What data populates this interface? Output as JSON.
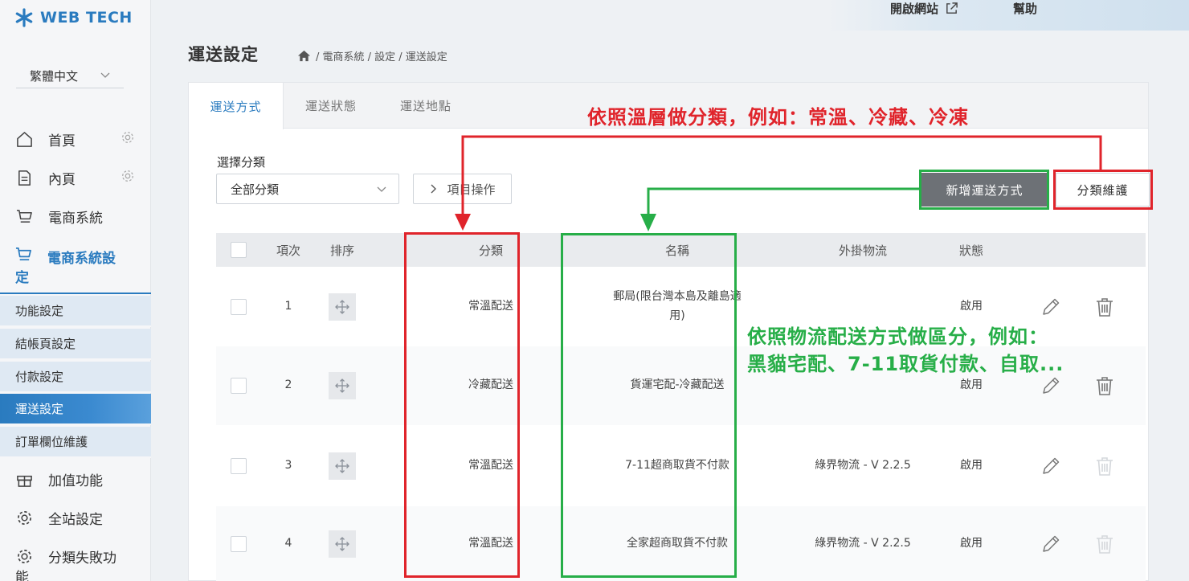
{
  "brand": {
    "name": "WEB TECH"
  },
  "language": {
    "selected": "繁體中文"
  },
  "topbar": {
    "open_site": "開啟網站",
    "help": "幫助"
  },
  "sidebar": {
    "items": [
      {
        "label": "首頁",
        "icon": "home-icon"
      },
      {
        "label": "內頁",
        "icon": "document-icon"
      },
      {
        "label": "電商系統",
        "icon": "cart-icon"
      }
    ],
    "active_section": {
      "label_line1": "電商系統設",
      "label_line2": "定",
      "icon": "cart-icon"
    },
    "sub_items": [
      {
        "label": "功能設定"
      },
      {
        "label": "結帳頁設定"
      },
      {
        "label": "付款設定"
      },
      {
        "label": "運送設定",
        "active": true
      },
      {
        "label": "訂單欄位維護"
      }
    ],
    "bottom_items": [
      {
        "label": "加值功能",
        "icon": "gift-icon"
      },
      {
        "label": "全站設定",
        "icon": "gear-icon"
      },
      {
        "label_line1": "分類失敗功",
        "label_line2": "能",
        "icon": "gear-icon"
      }
    ]
  },
  "header": {
    "title": "運送設定",
    "breadcrumb": "/ 電商系統 / 設定 / 運送設定"
  },
  "tabs": [
    {
      "label": "運送方式",
      "active": true
    },
    {
      "label": "運送狀態"
    },
    {
      "label": "運送地點"
    }
  ],
  "filter": {
    "label": "選擇分類",
    "selected": "全部分類",
    "ops_button": "項目操作"
  },
  "buttons": {
    "add": "新增運送方式",
    "category": "分類維護"
  },
  "table": {
    "headers": {
      "index": "項次",
      "sort": "排序",
      "category": "分類",
      "name": "名稱",
      "logistics": "外掛物流",
      "status": "狀態"
    },
    "rows": [
      {
        "index": "1",
        "category": "常溫配送",
        "name_line1": "郵局(限台灣本島及離島適",
        "name_line2": "用)",
        "logistics": "",
        "status": "啟用",
        "delete_enabled": true
      },
      {
        "index": "2",
        "category": "冷藏配送",
        "name_line1": "貨運宅配-冷藏配送",
        "name_line2": "",
        "logistics": "",
        "status": "啟用",
        "delete_enabled": true
      },
      {
        "index": "3",
        "category": "常溫配送",
        "name_line1": "7-11超商取貨不付款",
        "name_line2": "",
        "logistics": "綠界物流 - V 2.2.5",
        "status": "啟用",
        "delete_enabled": false
      },
      {
        "index": "4",
        "category": "常溫配送",
        "name_line1": "全家超商取貨不付款",
        "name_line2": "",
        "logistics": "綠界物流 - V 2.2.5",
        "status": "啟用",
        "delete_enabled": false
      }
    ]
  },
  "annotations": {
    "red_text": "依照溫層做分類，例如：常溫、冷藏、冷凍",
    "green_text_line1": "依照物流配送方式做區分，例如：",
    "green_text_line2": "黑貓宅配、7-11取貨付款、自取...",
    "red_color": "#e0242b",
    "green_color": "#27ae48"
  },
  "colors": {
    "accent": "#2a7bbf",
    "add_button": "#6d7176"
  }
}
